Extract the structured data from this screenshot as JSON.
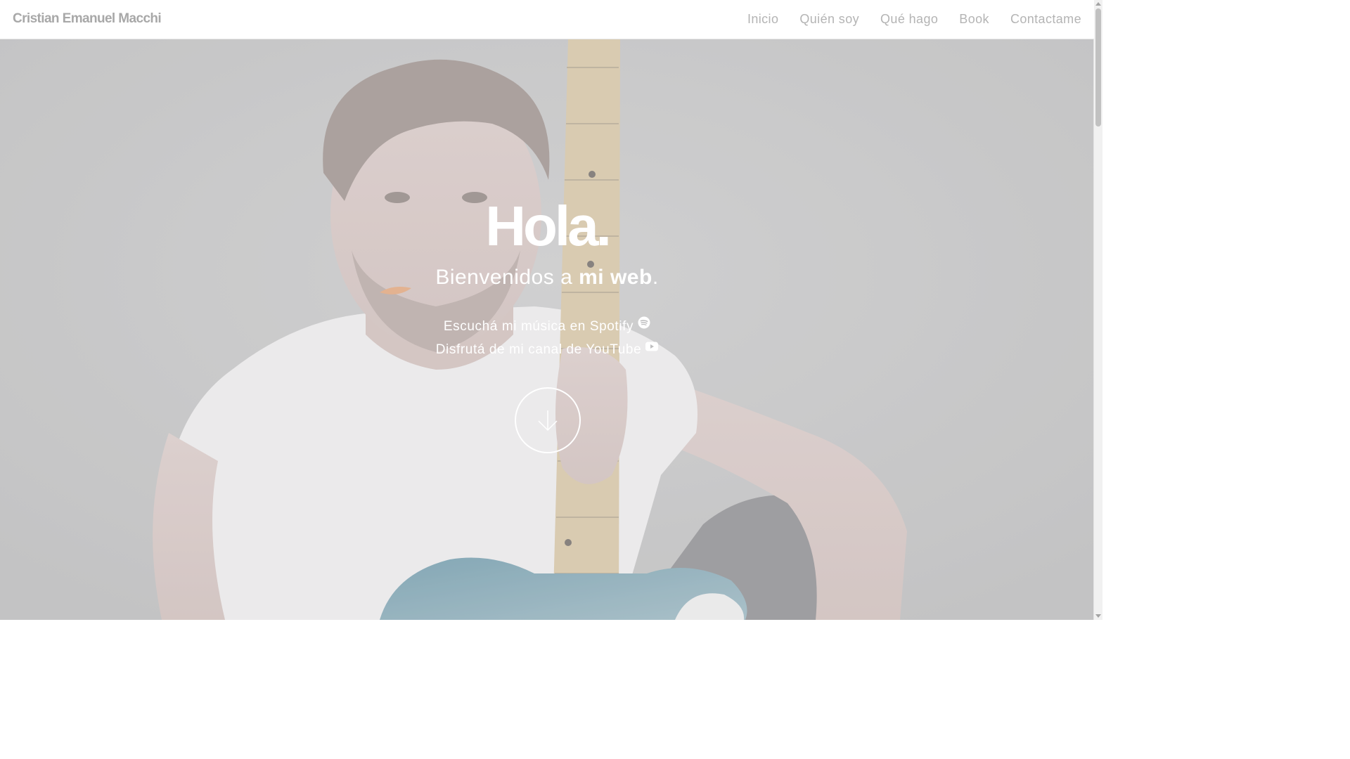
{
  "header": {
    "brand": "Cristian Emanuel Macchi",
    "nav": [
      {
        "label": "Inicio"
      },
      {
        "label": "Quién soy"
      },
      {
        "label": "Qué hago"
      },
      {
        "label": "Book"
      },
      {
        "label": "Contactame"
      }
    ]
  },
  "hero": {
    "title": "Hola.",
    "subtitle_prefix": "Bienvenidos a ",
    "subtitle_bold": "mi web",
    "subtitle_suffix": ".",
    "spotify_link": "Escuchá mi música en Spotify",
    "youtube_link": "Disfrutá de mi canal de YouTube",
    "spotify_icon": "spotify-icon",
    "youtube_icon": "youtube-icon",
    "scroll_icon": "arrow-down-icon"
  },
  "colors": {
    "brand_text": "#a8a8a8",
    "nav_text": "#b4b4b4",
    "hero_background": "#bfbfc0",
    "hero_text": "#ffffff"
  }
}
